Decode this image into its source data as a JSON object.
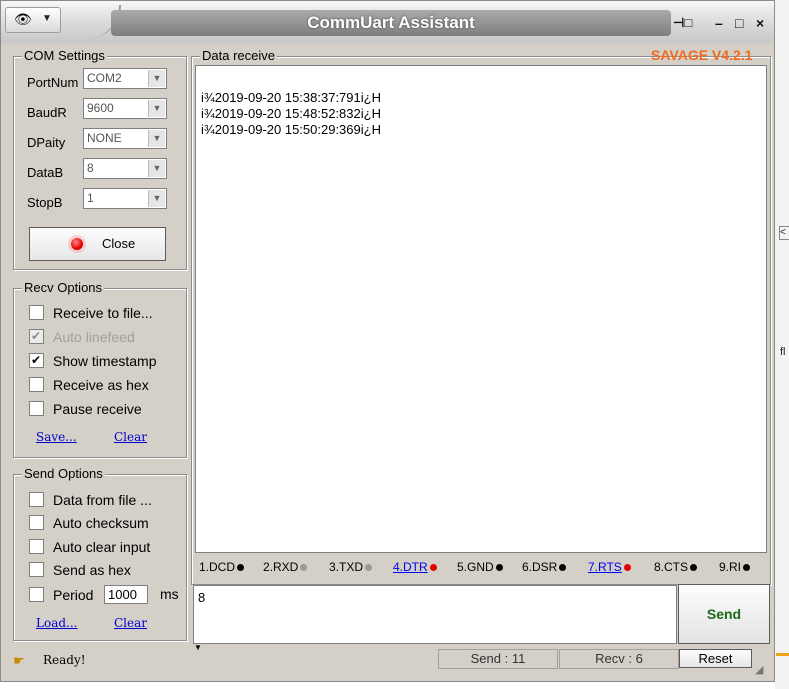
{
  "window": {
    "title": "CommUart Assistant",
    "version": "SAVAGE V4.2.1",
    "controls": {
      "pin": "⊣□",
      "minimize": "–",
      "maximize": "□",
      "close": "×"
    }
  },
  "com_settings": {
    "title": "COM Settings",
    "fields": [
      {
        "label": "PortNum",
        "value": "COM2"
      },
      {
        "label": "BaudR",
        "value": "9600"
      },
      {
        "label": "DPaity",
        "value": "NONE"
      },
      {
        "label": "DataB",
        "value": "8"
      },
      {
        "label": "StopB",
        "value": "1"
      }
    ],
    "close_button": "Close"
  },
  "recv_options": {
    "title": "Recv Options",
    "items": [
      {
        "label": "Receive to file...",
        "checked": false,
        "disabled": false
      },
      {
        "label": "Auto linefeed",
        "checked": true,
        "disabled": true
      },
      {
        "label": "Show timestamp",
        "checked": true,
        "disabled": false
      },
      {
        "label": "Receive as hex",
        "checked": false,
        "disabled": false
      },
      {
        "label": "Pause receive",
        "checked": false,
        "disabled": false
      }
    ],
    "save_link": "Save...",
    "clear_link": "Clear"
  },
  "send_options": {
    "title": "Send Options",
    "items": [
      {
        "label": "Data from file ...",
        "checked": false
      },
      {
        "label": "Auto checksum",
        "checked": false
      },
      {
        "label": "Auto clear input",
        "checked": false
      },
      {
        "label": "Send as hex",
        "checked": false
      }
    ],
    "period_label": "Period",
    "period_value": "1000",
    "period_unit": "ms",
    "load_link": "Load...",
    "clear_link": "Clear"
  },
  "data_receive": {
    "title": "Data receive",
    "lines": [
      "i¾2019-09-20 15:38:37:791i¿H",
      "i¾2019-09-20 15:48:52:832i¿H",
      "i¾2019-09-20 15:50:29:369i¿H"
    ]
  },
  "signals": [
    {
      "label": "1.DCD",
      "link": false,
      "dot": "black"
    },
    {
      "label": "2.RXD",
      "link": false,
      "dot": "gray"
    },
    {
      "label": "3.TXD",
      "link": false,
      "dot": "gray"
    },
    {
      "label": "4.DTR",
      "link": true,
      "dot": "red"
    },
    {
      "label": "5.GND",
      "link": false,
      "dot": "black"
    },
    {
      "label": "6.DSR",
      "link": false,
      "dot": "black"
    },
    {
      "label": "7.RTS",
      "link": true,
      "dot": "red"
    },
    {
      "label": "8.CTS",
      "link": false,
      "dot": "black"
    },
    {
      "label": "9.RI",
      "link": false,
      "dot": "black"
    }
  ],
  "send": {
    "input_value": "8",
    "button": "Send"
  },
  "status": {
    "ready": "Ready!",
    "send_count": "Send : 11",
    "recv_count": "Recv : 6",
    "reset": "Reset"
  },
  "background_fragments": [
    "fl",
    "<"
  ],
  "colors": {
    "version": "#f06a1f",
    "link": "#0000cc",
    "led_red": "#e40000",
    "send_text": "#1a6a1a"
  }
}
